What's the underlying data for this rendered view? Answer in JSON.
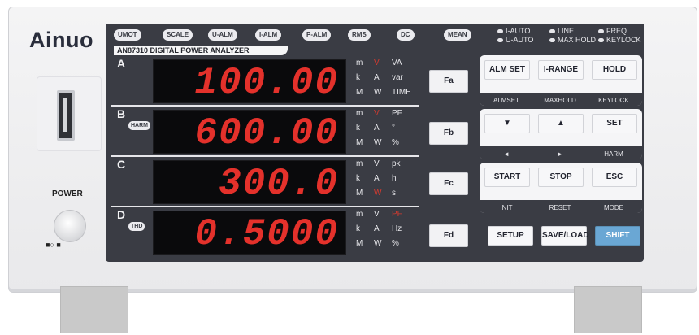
{
  "brand": "Ainuo",
  "model": "AN87310  DIGITAL POWER ANALYZER",
  "power_label": "POWER",
  "power_symbol": "■○  ■",
  "indicators": [
    "UMOT",
    "SCALE",
    "U-ALM",
    "I-ALM",
    "P-ALM",
    "RMS",
    "DC",
    "MEAN"
  ],
  "status_right": [
    {
      "label": "I-AUTO"
    },
    {
      "label": "U-AUTO"
    },
    {
      "label": "LINE"
    },
    {
      "label": "MAX HOLD"
    },
    {
      "label": "FREQ"
    },
    {
      "label": "KEYLOCK"
    }
  ],
  "rows": [
    {
      "letter": "A",
      "badge": "",
      "value": "100.00",
      "units": [
        "m",
        "V",
        "VA",
        "k",
        "A",
        "var",
        "M",
        "W",
        "TIME"
      ],
      "highlight": [
        "V"
      ]
    },
    {
      "letter": "B",
      "badge": "HARM",
      "value": "600.00",
      "units": [
        "m",
        "V",
        "PF",
        "k",
        "A",
        "°",
        "M",
        "W",
        "%"
      ],
      "highlight": [
        "V"
      ]
    },
    {
      "letter": "C",
      "badge": "",
      "value": "300.0",
      "units": [
        "m",
        "V",
        "pk",
        "k",
        "A",
        "h",
        "M",
        "W",
        "s"
      ],
      "highlight": [
        "W"
      ]
    },
    {
      "letter": "D",
      "badge": "THD",
      "value": "0.5000",
      "units": [
        "m",
        "V",
        "PF",
        "k",
        "A",
        "Hz",
        "M",
        "W",
        "%"
      ],
      "highlight": [
        "PF"
      ]
    }
  ],
  "function_buttons": [
    "Fa",
    "Fb",
    "Fc",
    "Fd"
  ],
  "panel1": {
    "keys": [
      "ALM SET",
      "I-RANGE",
      "HOLD"
    ],
    "subs": [
      "ALMSET",
      "MAXHOLD",
      "KEYLOCK"
    ]
  },
  "panel2": {
    "keys": [
      "▼",
      "▲",
      "SET"
    ],
    "subs": [
      "◄",
      "►",
      "HARM"
    ]
  },
  "panel3": {
    "keys": [
      "START",
      "STOP",
      "ESC"
    ],
    "subs": [
      "INIT",
      "RESET",
      "MODE"
    ]
  },
  "bottom_keys": [
    "SETUP",
    "SAVE/LOAD",
    "SHIFT"
  ],
  "colors": {
    "display_red": "#e4312b",
    "panel_dark": "#3a3c44",
    "shift_blue": "#6aa7d4"
  }
}
